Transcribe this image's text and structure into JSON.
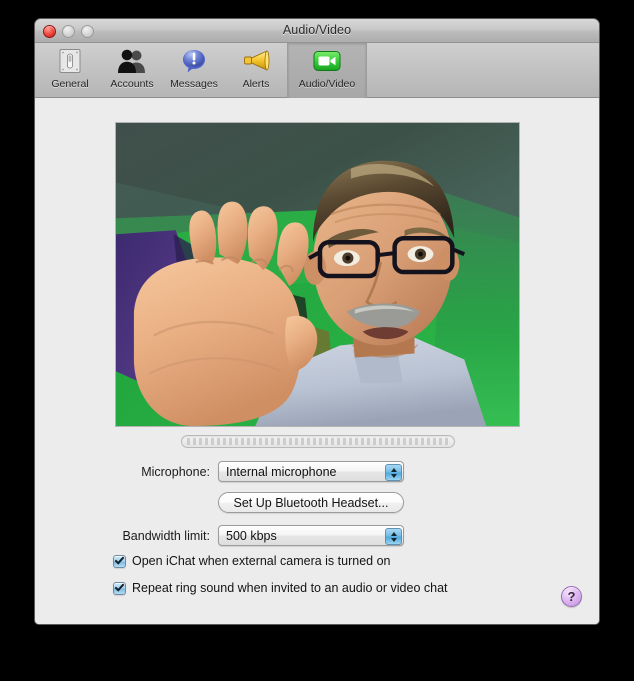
{
  "window": {
    "title": "Audio/Video",
    "controls": {
      "close": "close-button",
      "minimize": "minimize-button",
      "zoom": "zoom-button"
    }
  },
  "toolbar": {
    "items": [
      {
        "label": "General",
        "icon": "light-switch-icon",
        "selected": false
      },
      {
        "label": "Accounts",
        "icon": "people-icon",
        "selected": false
      },
      {
        "label": "Messages",
        "icon": "speech-bubble-icon",
        "selected": false
      },
      {
        "label": "Alerts",
        "icon": "megaphone-icon",
        "selected": false
      },
      {
        "label": "Audio/Video",
        "icon": "video-camera-icon",
        "selected": true
      }
    ]
  },
  "main": {
    "video_preview": {
      "name": "video-preview",
      "description": "Live camera preview: man with glasses and gray mustache raising his left hand toward the camera, green wall behind, purple garment at left"
    },
    "level_meter": {
      "name": "microphone-level-meter",
      "level": 0
    },
    "microphone": {
      "label": "Microphone:",
      "value": "Internal microphone",
      "options": [
        "Internal microphone"
      ]
    },
    "bluetooth_button": {
      "label": "Set Up Bluetooth Headset..."
    },
    "bandwidth": {
      "label": "Bandwidth limit:",
      "value": "500 kbps",
      "options": [
        "500 kbps"
      ]
    },
    "checkboxes": [
      {
        "label": "Open iChat when external camera is turned on",
        "checked": true
      },
      {
        "label": "Repeat ring sound when invited to an audio or video chat",
        "checked": true
      }
    ],
    "help": {
      "label": "?"
    }
  },
  "colors": {
    "window_background": "#ececec",
    "titlebar": "#c8c8c8",
    "accent_blue": "#74bce6",
    "help_purple": "#c08ede",
    "close_red": "#f4534a",
    "camera_green": "#37c740"
  }
}
